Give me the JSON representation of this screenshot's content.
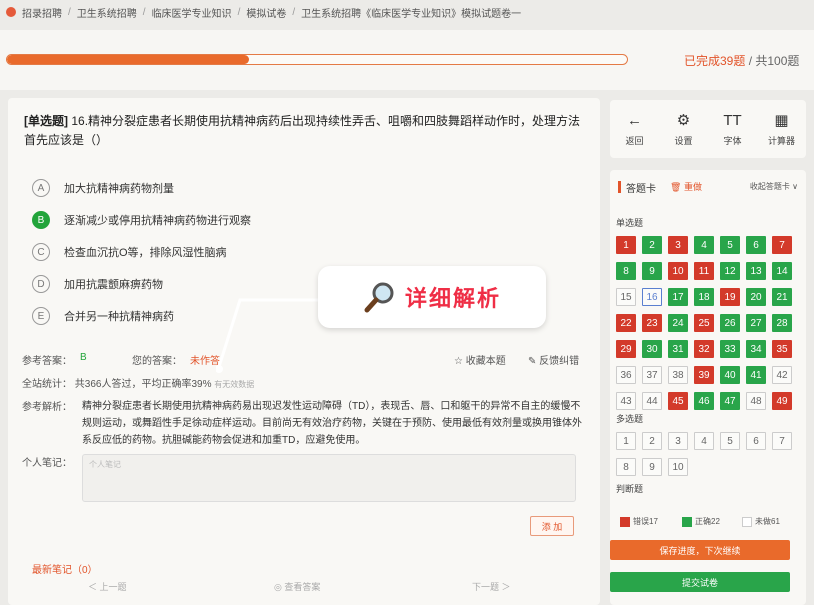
{
  "breadcrumb": {
    "items": [
      "招录招聘",
      "卫生系统招聘",
      "临床医学专业知识",
      "模拟试卷",
      "卫生系统招聘《临床医学专业知识》模拟试题卷一"
    ],
    "sep": "/"
  },
  "progress": {
    "done_text": "已完成39题",
    "total_text": " / 共100题",
    "fraction": 0.39
  },
  "question": {
    "type": "[单选题]",
    "text": "16.精神分裂症患者长期使用抗精神病药后出现持续性弄舌、咀嚼和四肢舞蹈样动作时，处理方法首先应该是（）",
    "options": [
      {
        "letter": "A",
        "text": "加大抗精神病药物剂量",
        "correct": false
      },
      {
        "letter": "B",
        "text": "逐渐减少或停用抗精神病药物进行观察",
        "correct": true
      },
      {
        "letter": "C",
        "text": "检查血沉抗O等，排除风湿性脑病",
        "correct": false
      },
      {
        "letter": "D",
        "text": "加用抗震颤麻痹药物",
        "correct": false
      },
      {
        "letter": "E",
        "text": "合并另一种抗精神病药",
        "correct": false
      }
    ]
  },
  "answer": {
    "ref_label": "参考答案：",
    "ref_value": "B",
    "mine_label": "您的答案：",
    "mine_value": "未作答",
    "favorite": "☆ 收藏本题",
    "feedback": "✎ 反馈纠错"
  },
  "stats": {
    "label": "全站统计：",
    "text": "共366人答过，平均正确率39%",
    "faint": "有无效数据"
  },
  "analysis": {
    "label": "参考解析：",
    "text": "精神分裂症患者长期使用抗精神病药易出现迟发性运动障碍（TD），表现舌、唇、口和躯干的异常不自主的缓慢不规则运动，或舞蹈性手足徐动症样运动。目前尚无有效治疗药物，关键在于预防、使用最低有效剂量或换用锥体外系反应低的药物。抗胆碱能药物会促进和加重TD，应避免使用。"
  },
  "notes": {
    "label": "个人笔记：",
    "placeholder": "个人笔记",
    "add": "添 加",
    "count": "最新笔记（0）"
  },
  "bottom_nav": {
    "prev": "＜ 上一题",
    "mid": "◎ 查看答案",
    "next": "下一题 ＞"
  },
  "callout": {
    "text": "详细解析",
    "icon": "magnifier-icon"
  },
  "tools": [
    {
      "icon": "back-arrow-icon",
      "glyph": "←",
      "label": "返回"
    },
    {
      "icon": "gear-icon",
      "glyph": "⚙",
      "label": "设置"
    },
    {
      "icon": "font-icon",
      "glyph": "TT",
      "label": "字体"
    },
    {
      "icon": "calculator-icon",
      "glyph": "▦",
      "label": "计算器"
    }
  ],
  "sheet": {
    "title": "答题卡",
    "reset": "重做",
    "collapse": "收起答题卡 ∨",
    "single_label": "单选题",
    "single": [
      {
        "n": "1",
        "s": "wrong"
      },
      {
        "n": "2",
        "s": "right"
      },
      {
        "n": "3",
        "s": "wrong"
      },
      {
        "n": "4",
        "s": "right"
      },
      {
        "n": "5",
        "s": "right"
      },
      {
        "n": "6",
        "s": "right"
      },
      {
        "n": "7",
        "s": "wrong"
      },
      {
        "n": "8",
        "s": "right"
      },
      {
        "n": "9",
        "s": "right"
      },
      {
        "n": "10",
        "s": "wrong"
      },
      {
        "n": "11",
        "s": "wrong"
      },
      {
        "n": "12",
        "s": "right"
      },
      {
        "n": "13",
        "s": "right"
      },
      {
        "n": "14",
        "s": "right"
      },
      {
        "n": "15",
        "s": "none"
      },
      {
        "n": "16",
        "s": "current"
      },
      {
        "n": "17",
        "s": "right"
      },
      {
        "n": "18",
        "s": "right"
      },
      {
        "n": "19",
        "s": "wrong"
      },
      {
        "n": "20",
        "s": "right"
      },
      {
        "n": "21",
        "s": "right"
      },
      {
        "n": "22",
        "s": "wrong"
      },
      {
        "n": "23",
        "s": "wrong"
      },
      {
        "n": "24",
        "s": "right"
      },
      {
        "n": "25",
        "s": "wrong"
      },
      {
        "n": "26",
        "s": "right"
      },
      {
        "n": "27",
        "s": "right"
      },
      {
        "n": "28",
        "s": "right"
      },
      {
        "n": "29",
        "s": "wrong"
      },
      {
        "n": "30",
        "s": "right"
      },
      {
        "n": "31",
        "s": "right"
      },
      {
        "n": "32",
        "s": "wrong"
      },
      {
        "n": "33",
        "s": "right"
      },
      {
        "n": "34",
        "s": "right"
      },
      {
        "n": "35",
        "s": "wrong"
      },
      {
        "n": "36",
        "s": "none"
      },
      {
        "n": "37",
        "s": "none"
      },
      {
        "n": "38",
        "s": "none"
      },
      {
        "n": "39",
        "s": "wrong"
      },
      {
        "n": "40",
        "s": "right"
      },
      {
        "n": "41",
        "s": "right"
      },
      {
        "n": "42",
        "s": "none"
      },
      {
        "n": "43",
        "s": "none"
      },
      {
        "n": "44",
        "s": "none"
      },
      {
        "n": "45",
        "s": "wrong"
      },
      {
        "n": "46",
        "s": "right"
      },
      {
        "n": "47",
        "s": "right"
      },
      {
        "n": "48",
        "s": "none"
      },
      {
        "n": "49",
        "s": "wrong"
      }
    ],
    "multi_label": "多选题",
    "multi": [
      "1",
      "2",
      "3",
      "4",
      "5",
      "6",
      "7",
      "8",
      "9",
      "10"
    ],
    "judge_label": "判断题",
    "legend": {
      "wrong": "错误17",
      "right": "正确22",
      "none": "未做61"
    },
    "save": "保存进度，下次继续",
    "submit": "提交试卷"
  },
  "colors": {
    "accent": "#e96a2b",
    "correct": "#29a54a",
    "wrong": "#d33a2a",
    "callout": "#ef2e46"
  }
}
